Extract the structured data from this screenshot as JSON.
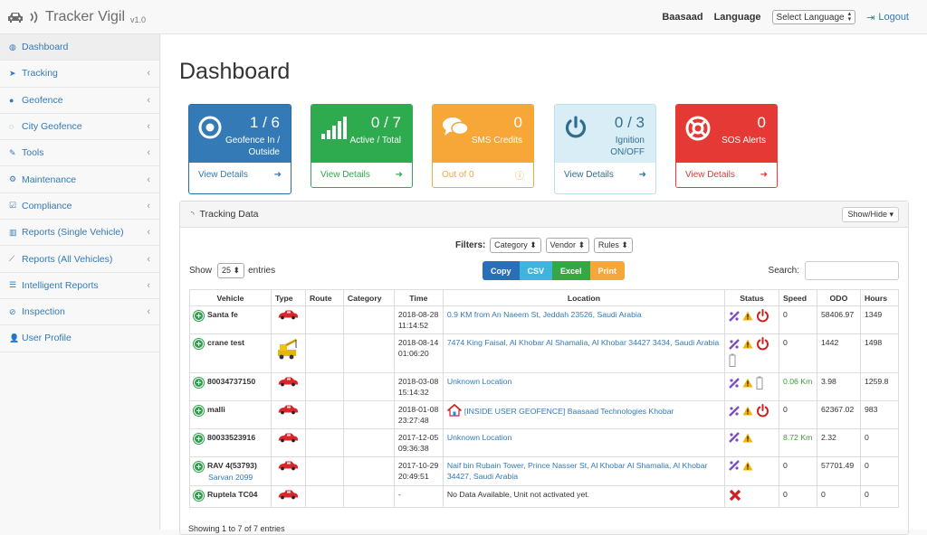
{
  "app": {
    "name": "Tracker Vigil",
    "version": "v1.0"
  },
  "topbar": {
    "user": "Baasaad",
    "language_label": "Language",
    "language_select": "Select Language",
    "logout": "Logout"
  },
  "sidebar": {
    "items": [
      {
        "label": "Dashboard",
        "icon": "dashboard-icon",
        "active": true
      },
      {
        "label": "Tracking",
        "icon": "location-arrow-icon",
        "chevron": true
      },
      {
        "label": "Geofence",
        "icon": "map-marker-icon",
        "chevron": true
      },
      {
        "label": "City Geofence",
        "icon": "circle-notch-icon",
        "chevron": true
      },
      {
        "label": "Tools",
        "icon": "wrench-icon",
        "chevron": true
      },
      {
        "label": "Maintenance",
        "icon": "cogs-icon",
        "chevron": true
      },
      {
        "label": "Compliance",
        "icon": "check-square-icon",
        "chevron": true
      },
      {
        "label": "Reports (Single Vehicle)",
        "icon": "bar-chart-icon",
        "chevron": true
      },
      {
        "label": "Reports (All Vehicles)",
        "icon": "line-chart-icon",
        "chevron": true
      },
      {
        "label": "Intelligent Reports",
        "icon": "list-icon",
        "chevron": true
      },
      {
        "label": "Inspection",
        "icon": "check-circle-icon",
        "chevron": true
      },
      {
        "label": "User Profile",
        "icon": "user-icon"
      }
    ]
  },
  "page_title": "Dashboard",
  "cards": [
    {
      "value": "1 / 6",
      "label1": "Geofence In /",
      "label2": "Outside",
      "footer": "View Details",
      "color": "#337ab7",
      "icon": "target-icon"
    },
    {
      "value": "0 / 7",
      "label1": "Active / Total",
      "label2": "",
      "footer": "View Details",
      "color": "#2fab4f",
      "icon": "signal-icon"
    },
    {
      "value": "0",
      "label1": "SMS Credits",
      "label2": "",
      "footer": "Out of 0",
      "color": "#f7a738",
      "icon": "comments-icon"
    },
    {
      "value": "0 / 3",
      "label1": "Ignition",
      "label2": "ON/OFF",
      "footer": "View Details",
      "color": "#d6ebf7",
      "icon": "power-icon"
    },
    {
      "value": "0",
      "label1": "SOS Alerts",
      "label2": "",
      "footer": "View Details",
      "color": "#e53935",
      "icon": "lifebuoy-icon"
    }
  ],
  "panel": {
    "title": "Tracking Data",
    "show_hide": "Show/Hide",
    "filters_label": "Filters:",
    "filters": [
      "Category",
      "Vendor",
      "Rules"
    ],
    "export_buttons": [
      {
        "label": "Copy",
        "color": "#2a6fb8"
      },
      {
        "label": "CSV",
        "color": "#3fb5dd"
      },
      {
        "label": "Excel",
        "color": "#35a845"
      },
      {
        "label": "Print",
        "color": "#f7a738"
      }
    ],
    "show_label": "Show",
    "entries_value": "25",
    "entries_label": "entries",
    "search_label": "Search:",
    "columns": [
      "Vehicle",
      "Type",
      "Route",
      "Category",
      "Time",
      "Location",
      "Status",
      "Speed",
      "ODO",
      "Hours"
    ],
    "rows": [
      {
        "vehicle": "Santa fe",
        "sub": "",
        "type": "car",
        "route": "",
        "category": "",
        "time1": "2018-08-28",
        "time2": "11:14:52",
        "location": "0.9 KM from An Naeem St, Jeddah 23526, Saudi Arabia",
        "location_geofence": false,
        "status": [
          "gps",
          "warning",
          "power"
        ],
        "speed": "0",
        "odo": "58406.97",
        "hours": "1349"
      },
      {
        "vehicle": "crane test",
        "sub": "",
        "type": "crane",
        "route": "",
        "category": "",
        "time1": "2018-08-14",
        "time2": "01:06:20",
        "location": "7474 King Faisal, Al Khobar Al Shamalia, Al Khobar 34427 3434, Saudi Arabia",
        "location_geofence": false,
        "status": [
          "gps",
          "warning",
          "power",
          "battery"
        ],
        "speed": "0",
        "odo": "1442",
        "hours": "1498"
      },
      {
        "vehicle": "80034737150",
        "sub": "",
        "type": "car",
        "route": "",
        "category": "",
        "time1": "2018-03-08",
        "time2": "15:14:32",
        "location": "Unknown Location",
        "location_geofence": false,
        "status": [
          "gps",
          "warning",
          "battery"
        ],
        "speed": "0.06 Km",
        "odo": "3.98",
        "hours": "1259.8"
      },
      {
        "vehicle": "malli",
        "sub": "",
        "type": "car",
        "route": "",
        "category": "",
        "time1": "2018-01-08",
        "time2": "23:27:48",
        "location": "[INSIDE USER GEOFENCE] Baasaad Technologies Khobar",
        "location_geofence": true,
        "status": [
          "gps",
          "warning",
          "power"
        ],
        "speed": "0",
        "odo": "62367.02",
        "hours": "983"
      },
      {
        "vehicle": "80033523916",
        "sub": "",
        "type": "car",
        "route": "",
        "category": "",
        "time1": "2017-12-05",
        "time2": "09:36:38",
        "location": "Unknown Location",
        "location_geofence": false,
        "status": [
          "gps",
          "warning"
        ],
        "speed": "8.72 Km",
        "odo": "2.32",
        "hours": "0"
      },
      {
        "vehicle": "RAV 4(53793)",
        "sub": "Sarvan 2099",
        "type": "car",
        "route": "",
        "category": "",
        "time1": "2017-10-29",
        "time2": "20:49:51",
        "location": "Naif bin Rubain Tower, Prince Nasser St, Al Khobar Al Shamalia, Al Khobar 34427, Saudi Arabia",
        "location_geofence": false,
        "status": [
          "gps",
          "warning"
        ],
        "speed": "0",
        "odo": "57701.49",
        "hours": "0"
      },
      {
        "vehicle": "Ruptela TC04",
        "sub": "",
        "type": "car",
        "route": "",
        "category": "",
        "time1": "-",
        "time2": "",
        "location": "No Data Available, Unit not activated yet.",
        "location_geofence": false,
        "location_plain": true,
        "status": [
          "cross"
        ],
        "speed": "0",
        "odo": "0",
        "hours": "0"
      }
    ],
    "footer_info": "Showing 1 to 7 of 7 entries"
  }
}
